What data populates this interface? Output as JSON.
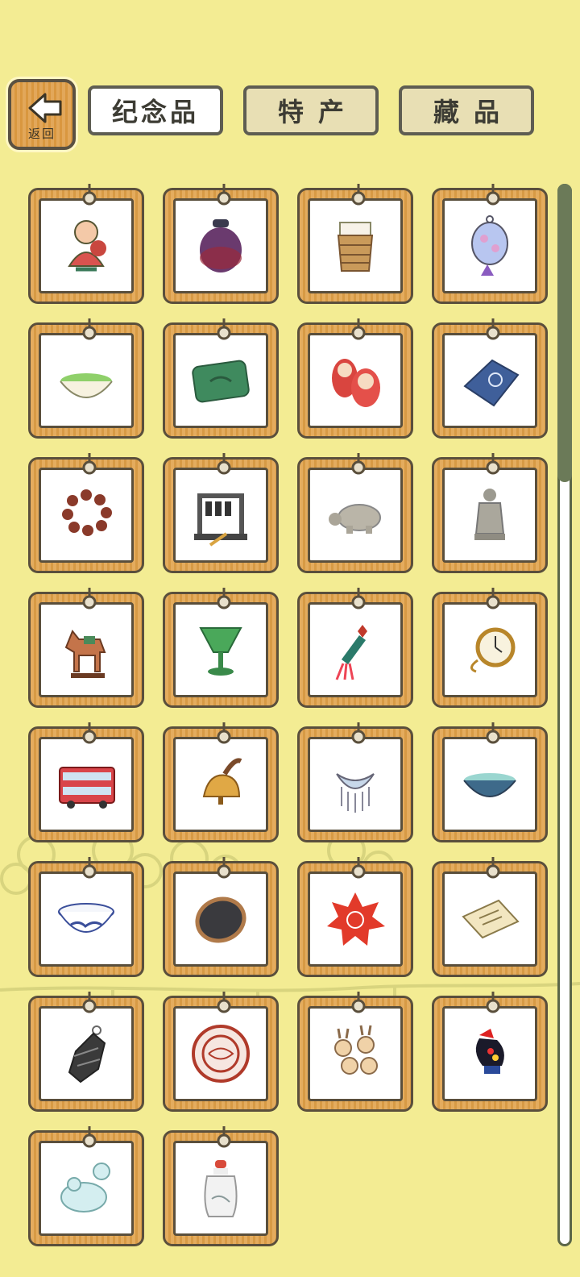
{
  "back": {
    "label": "返回",
    "icon": "back-arrow-icon"
  },
  "tabs": [
    {
      "label": "纪念品",
      "active": true
    },
    {
      "label": "特产",
      "active": false
    },
    {
      "label": "藏品",
      "active": false
    }
  ],
  "colors": {
    "background": "#f3ec93",
    "wood": "#dca052",
    "frame": "#5a4f3c"
  },
  "items": [
    "clay-doll-icon",
    "ceramic-jar-icon",
    "bamboo-cup-icon",
    "glass-lantern-icon",
    "matcha-bowl-icon",
    "jade-inkstone-icon",
    "matryoshka-icon",
    "blue-cloth-icon",
    "prayer-beads-icon",
    "bianzhong-bells-icon",
    "stone-turtle-icon",
    "terracotta-warrior-icon",
    "tang-horse-icon",
    "green-goblet-icon",
    "tassel-knot-icon",
    "pocket-watch-icon",
    "double-decker-bus-icon",
    "wooden-bell-icon",
    "silver-necklace-icon",
    "tea-bowl-icon",
    "porcelain-bowl-icon",
    "black-inkstone-icon",
    "red-paper-cut-icon",
    "passport-booklet-icon",
    "stone-pendant-icon",
    "red-seal-icon",
    "rabbit-dolls-icon",
    "barcelos-rooster-icon",
    "jade-frog-icon",
    "snuff-bottle-icon"
  ],
  "scroll": {
    "position": 0.0
  }
}
